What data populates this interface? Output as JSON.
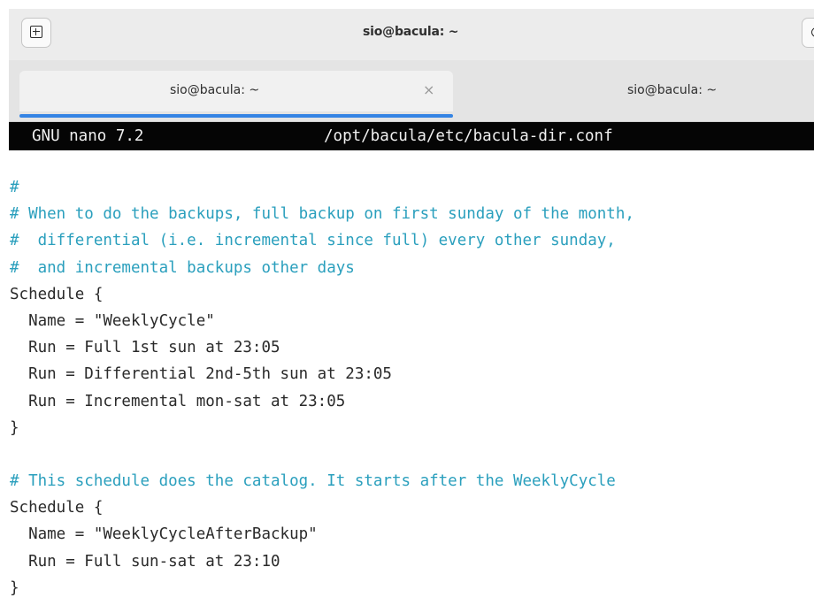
{
  "window": {
    "title": "sio@bacula: ~"
  },
  "icons": {
    "new_tab": "new-tab-icon",
    "search": "search-icon",
    "close_tab": "close-icon"
  },
  "tabs": [
    {
      "label": "sio@bacula: ~",
      "close": "×",
      "active": true
    },
    {
      "label": "sio@bacula: ~",
      "active": false
    }
  ],
  "nano": {
    "version": "GNU nano 7.2",
    "file_path": "/opt/bacula/etc/bacula-dir.conf"
  },
  "colors": {
    "comment": "#2a9fbd",
    "accent": "#3584e4",
    "header_bg": "#050505"
  },
  "lines": [
    {
      "text": "#",
      "comment": true
    },
    {
      "text": "# When to do the backups, full backup on first sunday of the month,",
      "comment": true
    },
    {
      "text": "#  differential (i.e. incremental since full) every other sunday,",
      "comment": true
    },
    {
      "text": "#  and incremental backups other days",
      "comment": true
    },
    {
      "text": "Schedule {",
      "comment": false
    },
    {
      "text": "  Name = \"WeeklyCycle\"",
      "comment": false
    },
    {
      "text": "  Run = Full 1st sun at 23:05",
      "comment": false
    },
    {
      "text": "  Run = Differential 2nd-5th sun at 23:05",
      "comment": false
    },
    {
      "text": "  Run = Incremental mon-sat at 23:05",
      "comment": false
    },
    {
      "text": "}",
      "comment": false
    },
    {
      "text": "",
      "comment": false
    },
    {
      "text": "# This schedule does the catalog. It starts after the WeeklyCycle",
      "comment": true
    },
    {
      "text": "Schedule {",
      "comment": false
    },
    {
      "text": "  Name = \"WeeklyCycleAfterBackup\"",
      "comment": false
    },
    {
      "text": "  Run = Full sun-sat at 23:10",
      "comment": false
    },
    {
      "text": "}",
      "comment": false
    }
  ]
}
